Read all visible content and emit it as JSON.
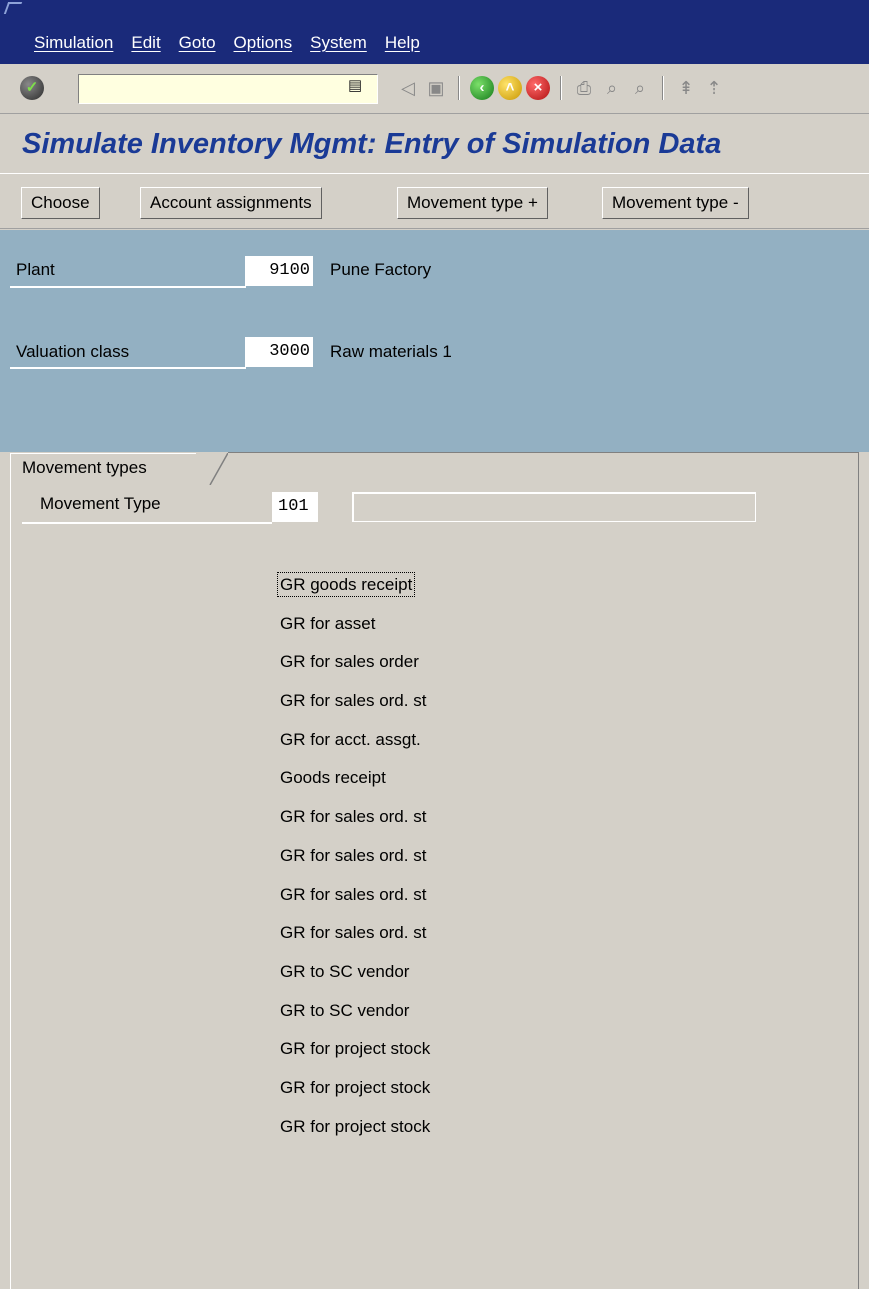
{
  "menu": {
    "items": [
      "Simulation",
      "Edit",
      "Goto",
      "Options",
      "System",
      "Help"
    ]
  },
  "toolbar": {
    "command_value": "",
    "icons": [
      "enter-icon",
      "back-icon",
      "save-icon",
      "back-green-icon",
      "exit-icon",
      "cancel-icon",
      "print-icon",
      "find-icon",
      "find-next-icon",
      "first-page-icon",
      "previous-page-icon"
    ]
  },
  "page": {
    "title": "Simulate Inventory Mgmt: Entry of Simulation Data"
  },
  "app_toolbar": {
    "choose": "Choose",
    "account_assignments": "Account assignments",
    "movement_type_plus": "Movement type +",
    "movement_type_minus": "Movement type -"
  },
  "header": {
    "plant_label": "Plant",
    "plant_value": "9100",
    "plant_desc": "Pune Factory",
    "valuation_label": "Valuation class",
    "valuation_value": "3000",
    "valuation_desc": "Raw materials 1"
  },
  "tab": {
    "label": "Movement types"
  },
  "movement": {
    "label": "Movement Type",
    "value": "101",
    "description": "",
    "items": [
      "GR goods receipt",
      "GR for asset",
      "GR for sales order",
      "GR for sales ord. st",
      "GR for acct. assgt.",
      "Goods receipt",
      "GR for sales ord. st",
      "GR for sales ord. st",
      "GR for sales ord. st",
      "GR for sales ord. st",
      "GR to SC vendor",
      "GR to SC vendor",
      "GR for project stock",
      "GR for project stock",
      "GR for project stock"
    ]
  },
  "colors": {
    "menubar": "#1a2a7a",
    "title": "#1a3a96",
    "header_bg": "#93b0c2",
    "panel_bg": "#d4d0c8"
  }
}
